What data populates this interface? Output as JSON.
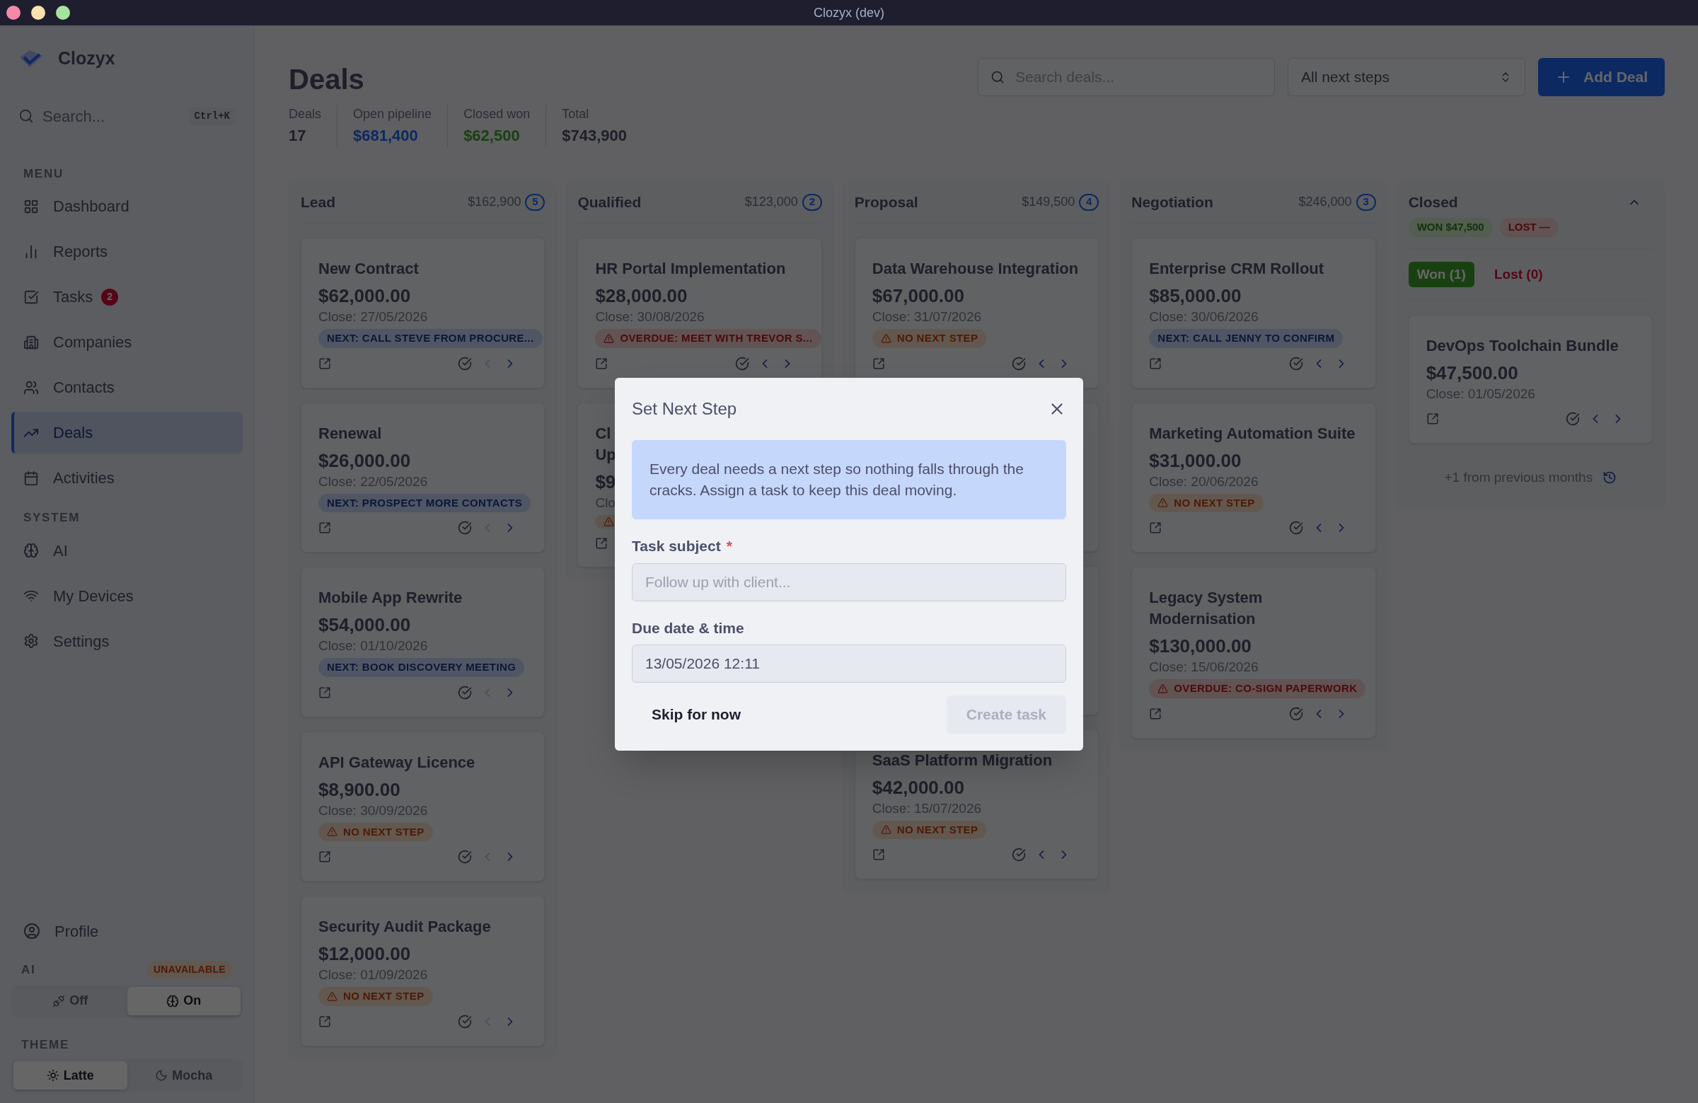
{
  "window": {
    "title": "Clozyx (dev)"
  },
  "sidebar": {
    "app_name": "Clozyx",
    "search": {
      "placeholder": "Search...",
      "shortcut": "Ctrl+K"
    },
    "sections": [
      {
        "heading": "MENU",
        "items": [
          {
            "label": "Dashboard",
            "selected": false
          },
          {
            "label": "Reports",
            "selected": false
          },
          {
            "label": "Tasks",
            "selected": false,
            "badge": "2"
          },
          {
            "label": "Companies",
            "selected": false
          },
          {
            "label": "Contacts",
            "selected": false
          },
          {
            "label": "Deals",
            "selected": true
          },
          {
            "label": "Activities",
            "selected": false
          }
        ]
      },
      {
        "heading": "SYSTEM",
        "items": [
          {
            "label": "AI",
            "selected": false
          },
          {
            "label": "My Devices",
            "selected": false
          },
          {
            "label": "Settings",
            "selected": false
          }
        ]
      }
    ],
    "profile": {
      "label": "Profile"
    },
    "ai": {
      "heading": "AI",
      "status": "UNAVAILABLE",
      "options": [
        {
          "label": "Off",
          "selected": false
        },
        {
          "label": "On",
          "selected": true
        }
      ]
    },
    "theme": {
      "heading": "THEME",
      "options": [
        {
          "label": "Latte",
          "selected": true
        },
        {
          "label": "Mocha",
          "selected": false
        }
      ]
    }
  },
  "page": {
    "title": "Deals",
    "stats": [
      {
        "label": "Deals",
        "value": "17",
        "kind": "plain"
      },
      {
        "label": "Open pipeline",
        "value": "$681,400",
        "kind": "open"
      },
      {
        "label": "Closed won",
        "value": "$62,500",
        "kind": "won"
      },
      {
        "label": "Total",
        "value": "$743,900",
        "kind": "plain"
      }
    ],
    "search": {
      "placeholder": "Search deals..."
    },
    "filter": {
      "value": "All next steps"
    },
    "add_button": {
      "label": "Add Deal"
    }
  },
  "columns": [
    {
      "kind": "stage",
      "name": "Lead",
      "total": "$162,900",
      "count": "5",
      "cards": [
        {
          "kind": "deal",
          "title": "New Contract",
          "amount": "$62,000.00",
          "close": "Close: 27/05/2026",
          "next_step": {
            "kind": "next",
            "text": "NEXT: CALL STEVE FROM PROCURE..."
          },
          "prev_disabled": true
        },
        {
          "kind": "deal",
          "title": "Renewal",
          "amount": "$26,000.00",
          "close": "Close: 22/05/2026",
          "next_step": {
            "kind": "next",
            "text": "NEXT: PROSPECT MORE CONTACTS"
          },
          "prev_disabled": true
        },
        {
          "kind": "deal",
          "title": "Mobile App Rewrite",
          "amount": "$54,000.00",
          "close": "Close: 01/10/2026",
          "next_step": {
            "kind": "next",
            "text": "NEXT: BOOK DISCOVERY MEETING"
          },
          "prev_disabled": true
        },
        {
          "kind": "deal",
          "title": "API Gateway Licence",
          "amount": "$8,900.00",
          "close": "Close: 30/09/2026",
          "next_step": {
            "kind": "none",
            "text": "NO NEXT STEP"
          },
          "prev_disabled": true
        },
        {
          "kind": "deal",
          "title": "Security Audit Package",
          "amount": "$12,000.00",
          "close": "Close: 01/09/2026",
          "next_step": {
            "kind": "none",
            "text": "NO NEXT STEP"
          },
          "prev_disabled": true
        }
      ]
    },
    {
      "kind": "stage",
      "name": "Qualified",
      "total": "$123,000",
      "count": "2",
      "cards": [
        {
          "kind": "deal",
          "title": "HR Portal Implementation",
          "amount": "$28,000.00",
          "close": "Close: 30/08/2026",
          "next_step": {
            "kind": "overdue",
            "text": "OVERDUE: MEET WITH TREVOR S..."
          },
          "prev_disabled": false
        },
        {
          "kind": "partial",
          "title_lines": [
            "Cl",
            "Up"
          ],
          "amount": "$9",
          "close": "Clo",
          "next_step": {
            "kind": "none"
          }
        }
      ]
    },
    {
      "kind": "stage",
      "name": "Proposal",
      "total": "$149,500",
      "count": "4",
      "cards": [
        {
          "kind": "deal",
          "title": "Data Warehouse Integration",
          "amount": "$67,000.00",
          "close": "Close: 31/07/2026",
          "next_step": {
            "kind": "none",
            "text": "NO NEXT STEP"
          },
          "prev_disabled": false
        },
        {
          "kind": "covered"
        },
        {
          "kind": "covered"
        },
        {
          "kind": "deal",
          "title": "SaaS Platform Migration",
          "amount": "$42,000.00",
          "close": "Close: 15/07/2026",
          "next_step": {
            "kind": "none",
            "text": "NO NEXT STEP"
          },
          "prev_disabled": false
        }
      ]
    },
    {
      "kind": "stage",
      "name": "Negotiation",
      "total": "$246,000",
      "count": "3",
      "cards": [
        {
          "kind": "deal",
          "title": "Enterprise CRM Rollout",
          "amount": "$85,000.00",
          "close": "Close: 30/06/2026",
          "next_step": {
            "kind": "next",
            "text": "NEXT: CALL JENNY TO CONFIRM"
          },
          "prev_disabled": false
        },
        {
          "kind": "deal",
          "title": "Marketing Automation Suite",
          "amount": "$31,000.00",
          "close": "Close: 20/06/2026",
          "next_step": {
            "kind": "none",
            "text": "NO NEXT STEP"
          },
          "prev_disabled": false
        },
        {
          "kind": "deal",
          "title": "Legacy System Modernisation",
          "amount": "$130,000.00",
          "close": "Close: 15/06/2026",
          "next_step": {
            "kind": "overdue",
            "text": "OVERDUE: CO-SIGN PAPERWORK"
          },
          "prev_disabled": false
        }
      ]
    },
    {
      "kind": "closed",
      "name": "Closed",
      "expanded": true,
      "won_total": "WON $47,500",
      "lost_total": "LOST —",
      "tabs": [
        {
          "label": "Won (1)",
          "selected": true,
          "kind": "won"
        },
        {
          "label": "Lost (0)",
          "selected": false,
          "kind": "lost"
        }
      ],
      "cards": [
        {
          "kind": "deal",
          "title": "DevOps Toolchain Bundle",
          "amount": "$47,500.00",
          "close": "Close: 01/05/2026",
          "prev_disabled": false
        }
      ],
      "footer": "+1 from previous months"
    }
  ],
  "modal": {
    "title": "Set Next Step",
    "notice": "Every deal needs a next step so nothing falls through the cracks. Assign a task to keep this deal moving.",
    "fields": [
      {
        "label": "Task subject",
        "required_marker": "*",
        "placeholder": "Follow up with client..."
      },
      {
        "label": "Due date & time",
        "value": "13/05/2026 12:11"
      }
    ],
    "buttons": [
      {
        "label": "Skip for now",
        "disabled": false
      },
      {
        "label": "Create task",
        "disabled": true
      }
    ]
  }
}
